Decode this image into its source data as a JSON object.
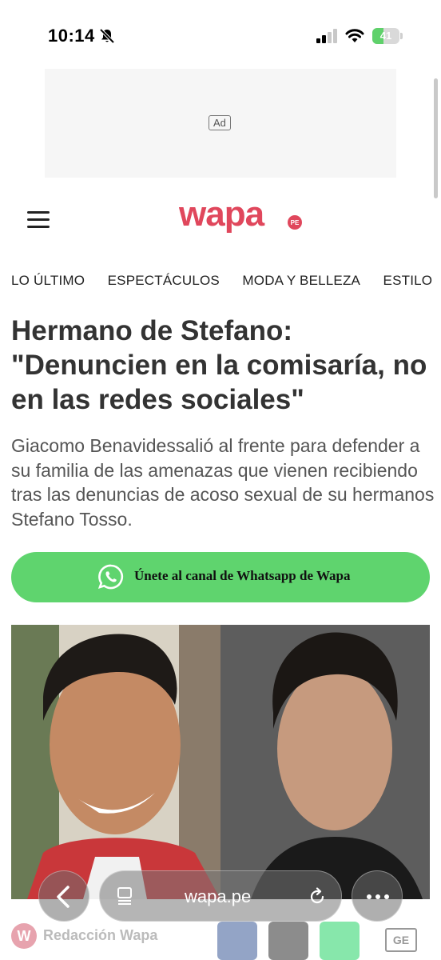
{
  "status_bar": {
    "time": "10:14",
    "battery": "41",
    "battery_level": 0.41
  },
  "ad": {
    "label": "Ad"
  },
  "header": {
    "logo": "wapa",
    "logo_suffix": "PE"
  },
  "nav": [
    "LO ÚLTIMO",
    "ESPECTÁCULOS",
    "MODA Y BELLEZA",
    "ESTILO"
  ],
  "article": {
    "headline": "Hermano de Stefano: \"Denuncien en la comisaría, no en las redes sociales\"",
    "summary": "Giacomo Benavidessalió al frente para defender a su familia de las amenazas que vienen recibiendo tras las denuncias de acoso sexual de su hermanos Stefano Tosso.",
    "whatsapp_cta": "Únete al canal de Whatsapp de Wapa",
    "byline_initial": "W",
    "byline": "Redacción Wapa",
    "share_ge": "GE"
  },
  "browser": {
    "url": "wapa.pe"
  },
  "colors": {
    "brand": "#e0475c",
    "whatsapp": "#5fd46e",
    "battery": "#5fd16b"
  }
}
